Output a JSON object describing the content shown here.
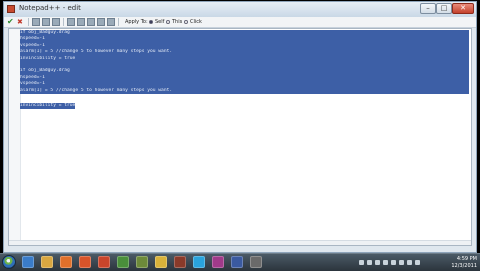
{
  "window": {
    "title": "Notepad++ - edit",
    "min_label": "–",
    "max_label": "□",
    "close_label": "✕"
  },
  "toolbar": {
    "apply_label": "Apply To:",
    "options": [
      {
        "label": "Self",
        "selected": true
      },
      {
        "label": "This",
        "selected": false
      },
      {
        "label": "Click",
        "selected": false
      }
    ]
  },
  "editor": {
    "lines": [
      {
        "text": "if obj_Badguy.drag",
        "selected": true
      },
      {
        "text": "hspeed=-1",
        "selected": true
      },
      {
        "text": "vspeed=-1",
        "selected": true
      },
      {
        "text": "alarm[1] = 5 //change 5 to however many steps you want.",
        "selected": true
      },
      {
        "text": "invincibility = true",
        "selected": true
      },
      {
        "text": "",
        "selected": true
      },
      {
        "text": "if obj_Badguy.drag",
        "selected": true
      },
      {
        "text": "hspeed=-1",
        "selected": true
      },
      {
        "text": "vspeed=-1",
        "selected": true
      },
      {
        "text": "alarm[1] = 5 //change 5 to however many steps you want.",
        "selected": true
      },
      {
        "text": "invincibility = true",
        "selected": "partial"
      }
    ]
  },
  "taskbar": {
    "icons": [
      {
        "name": "ie-icon",
        "color": "#3a7cc9"
      },
      {
        "name": "folder-icon",
        "color": "#d9a741"
      },
      {
        "name": "media-player-icon",
        "color": "#e0702b"
      },
      {
        "name": "firefox-icon",
        "color": "#d8542a"
      },
      {
        "name": "game-maker-icon",
        "color": "#c9452b"
      },
      {
        "name": "app-icon-6",
        "color": "#4a8f3b"
      },
      {
        "name": "app-icon-7",
        "color": "#6d8a3a"
      },
      {
        "name": "chrome-icon",
        "color": "#d9b23a"
      },
      {
        "name": "app-icon-9",
        "color": "#8a3a2a"
      },
      {
        "name": "skype-icon",
        "color": "#2aa3dc"
      },
      {
        "name": "app-icon-11",
        "color": "#a03a8a"
      },
      {
        "name": "app-icon-12",
        "color": "#3a5aa0"
      },
      {
        "name": "app-icon-13",
        "color": "#6a6a6a"
      }
    ],
    "clock_time": "4:59 PM",
    "clock_date": "12/3/2011"
  }
}
